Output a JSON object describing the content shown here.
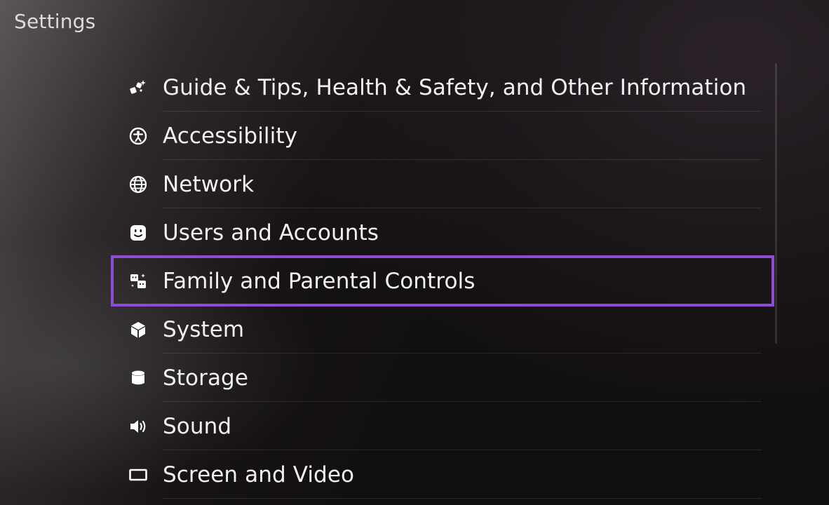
{
  "page": {
    "title": "Settings"
  },
  "menu": {
    "items": [
      {
        "label": "Guide & Tips, Health & Safety, and Other Information",
        "icon": "guide-tips-icon"
      },
      {
        "label": "Accessibility",
        "icon": "accessibility-icon"
      },
      {
        "label": "Network",
        "icon": "globe-icon"
      },
      {
        "label": "Users and Accounts",
        "icon": "user-face-icon"
      },
      {
        "label": "Family and Parental Controls",
        "icon": "family-icon"
      },
      {
        "label": "System",
        "icon": "cube-icon"
      },
      {
        "label": "Storage",
        "icon": "cylinder-icon"
      },
      {
        "label": "Sound",
        "icon": "speaker-icon"
      },
      {
        "label": "Screen and Video",
        "icon": "screen-icon"
      }
    ],
    "selected_label": "Family and Parental Controls"
  },
  "colors": {
    "selection_outline": "#8f4bd6",
    "text": "#f2f0f2"
  }
}
